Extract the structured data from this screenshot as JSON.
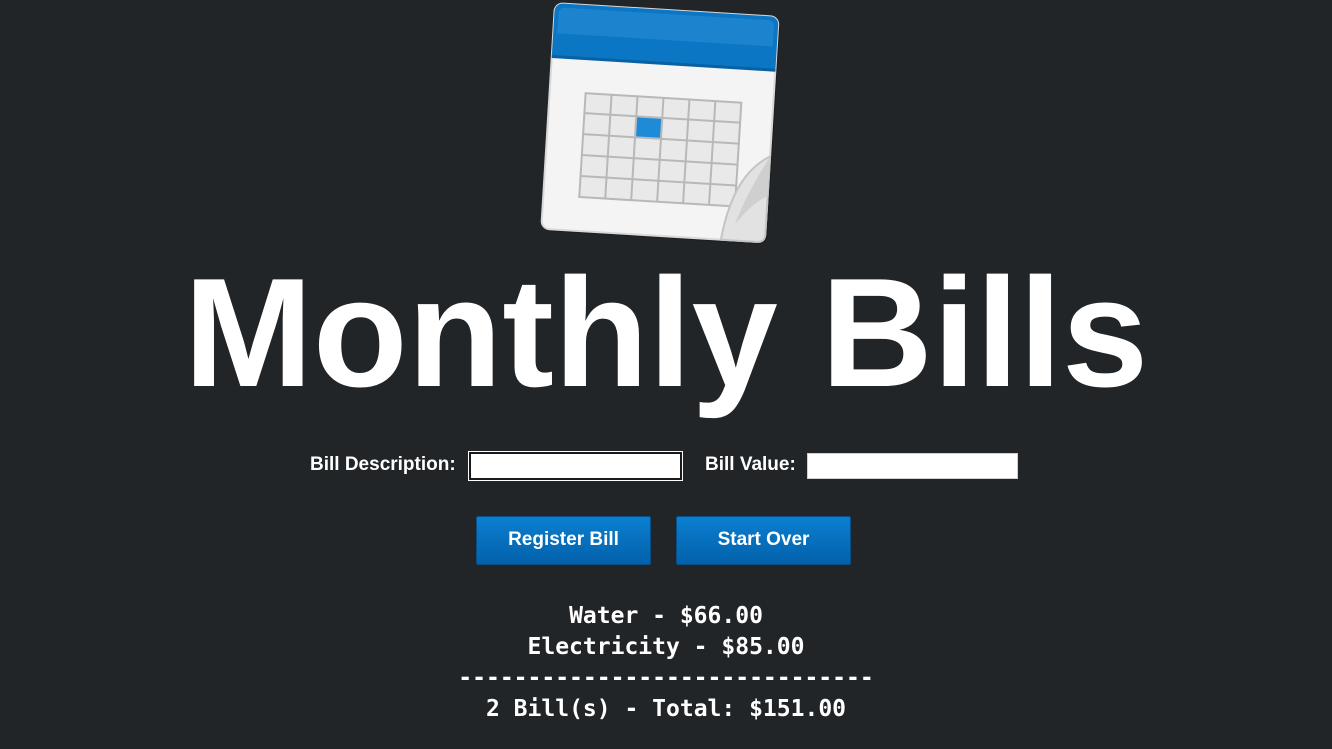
{
  "app": {
    "title": "Monthly Bills",
    "logo_icon": "calendar-icon"
  },
  "form": {
    "description_label": "Bill Description:",
    "description_value": "",
    "value_label": "Bill Value:",
    "value_value": ""
  },
  "buttons": {
    "register_label": "Register Bill",
    "start_over_label": "Start Over"
  },
  "bills": {
    "items": [
      "Water - $66.00",
      "Electricity - $85.00"
    ],
    "separator": "------------------------------",
    "summary": "2 Bill(s) - Total: $151.00"
  },
  "colors": {
    "background": "#222528",
    "button": "#0670bf",
    "calendar_accent": "#0a76c4",
    "text": "#ffffff"
  }
}
